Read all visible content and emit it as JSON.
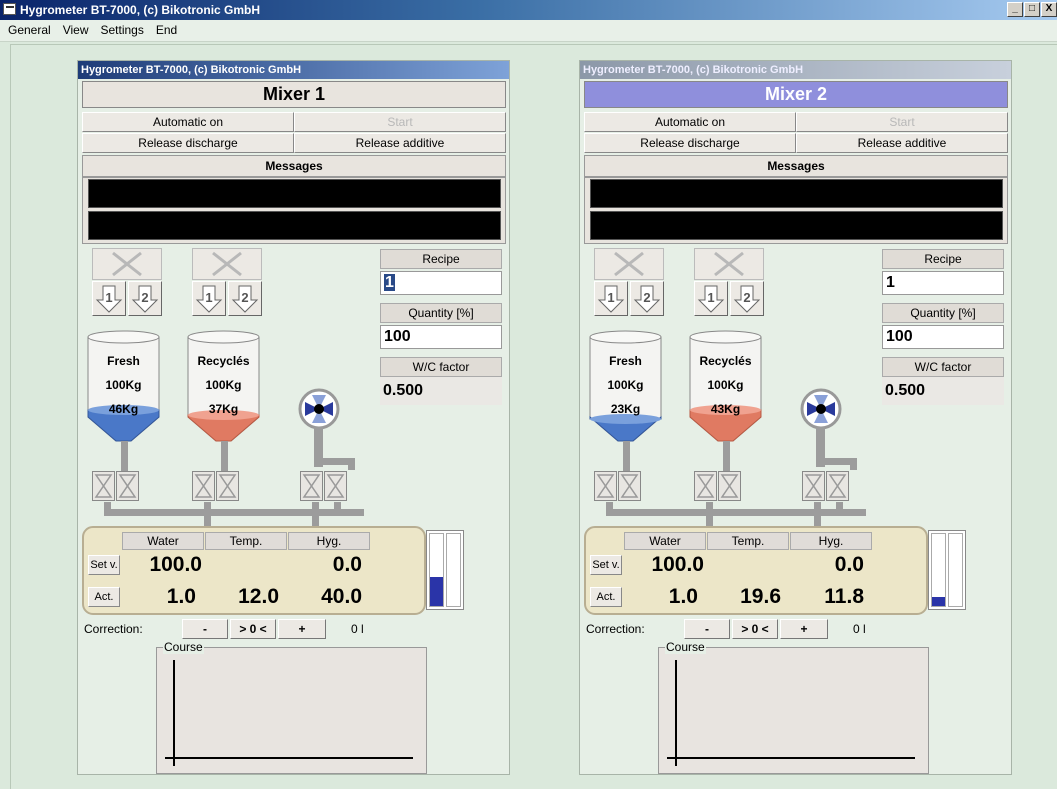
{
  "window": {
    "title": "Hygrometer BT-7000, (c) Bikotronic GmbH",
    "min": "_",
    "max": "□",
    "close": "X"
  },
  "menu": [
    "General",
    "View",
    "Settings",
    "End"
  ],
  "colors": {
    "tank_fresh": "#4a78c8",
    "tank_recycled": "#e07a62",
    "gauge_fill": "#2a34a8"
  },
  "icons": {
    "fan": "fan-icon",
    "close_x": "x-icon",
    "arrow": "arrow-down-icon",
    "valve": "valve-icon"
  },
  "panels": [
    {
      "title": "Hygrometer BT-7000, (c) Bikotronic GmbH",
      "mixer": "Mixer 1",
      "btn_auto": "Automatic on",
      "btn_start": "Start",
      "btn_discharge": "Release discharge",
      "btn_additive": "Release additive",
      "messages_label": "Messages",
      "arrow1": "1",
      "arrow2": "2",
      "recipe_label": "Recipe",
      "recipe_value": "1",
      "quantity_label": "Quantity [%]",
      "quantity_value": "100",
      "wc_label": "W/C factor",
      "wc_value": "0.500",
      "tank1": {
        "name": "Fresh",
        "capacity": "100Kg",
        "current": "46Kg",
        "fill": 0.46
      },
      "tank2": {
        "name": "Recyclés",
        "capacity": "100Kg",
        "current": "37Kg",
        "fill": 0.37
      },
      "col_water": "Water",
      "col_temp": "Temp.",
      "col_hyg": "Hyg.",
      "setv_label": "Set v.",
      "act_label": "Act.",
      "set_water": "100.0",
      "set_hyg": "0.0",
      "act_water": "1.0",
      "act_temp": "12.0",
      "act_hyg": "40.0",
      "gauge_level": 0.4,
      "correction_label": "Correction:",
      "corr_minus": "-",
      "corr_zero": "> 0 <",
      "corr_plus": "+",
      "corr_value": "0 l",
      "course_label": "Course"
    },
    {
      "title": "Hygrometer BT-7000, (c) Bikotronic GmbH",
      "mixer": "Mixer 2",
      "btn_auto": "Automatic on",
      "btn_start": "Start",
      "btn_discharge": "Release discharge",
      "btn_additive": "Release additive",
      "messages_label": "Messages",
      "arrow1": "1",
      "arrow2": "2",
      "recipe_label": "Recipe",
      "recipe_value": "1",
      "quantity_label": "Quantity [%]",
      "quantity_value": "100",
      "wc_label": "W/C factor",
      "wc_value": "0.500",
      "tank1": {
        "name": "Fresh",
        "capacity": "100Kg",
        "current": "23Kg",
        "fill": 0.23
      },
      "tank2": {
        "name": "Recyclés",
        "capacity": "100Kg",
        "current": "43Kg",
        "fill": 0.43
      },
      "col_water": "Water",
      "col_temp": "Temp.",
      "col_hyg": "Hyg.",
      "setv_label": "Set v.",
      "act_label": "Act.",
      "set_water": "100.0",
      "set_hyg": "0.0",
      "act_water": "1.0",
      "act_temp": "19.6",
      "act_hyg": "11.8",
      "gauge_level": 0.12,
      "correction_label": "Correction:",
      "corr_minus": "-",
      "corr_zero": "> 0 <",
      "corr_plus": "+",
      "corr_value": "0 l",
      "course_label": "Course"
    }
  ]
}
